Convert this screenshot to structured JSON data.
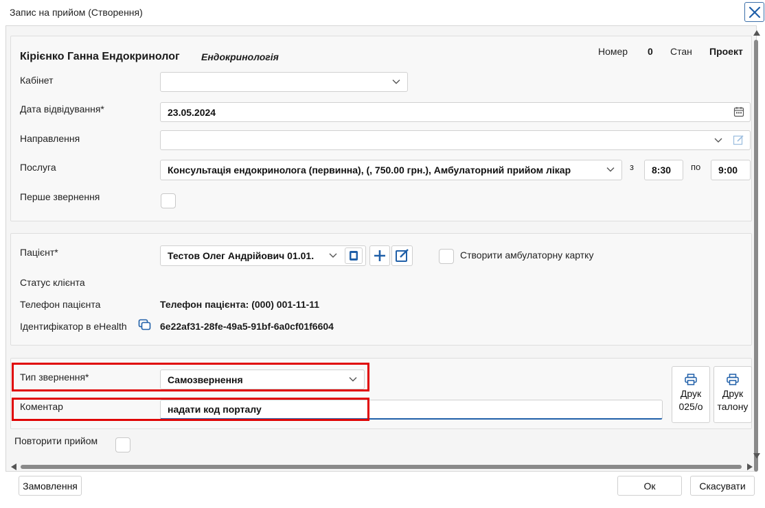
{
  "window": {
    "title": "Запис на прийом (Створення)"
  },
  "header": {
    "doctor": "Кірієнко Ганна Ендокринолог",
    "specialty": "Ендокринологія",
    "number_label": "Номер",
    "number_value": "0",
    "state_label": "Стан",
    "state_value": "Проект"
  },
  "form": {
    "cabinet_label": "Кабінет",
    "cabinet_value": "",
    "date_label": "Дата відвідування*",
    "date_value": "23.05.2024",
    "referral_label": "Направлення",
    "referral_value": "",
    "service_label": "Послуга",
    "service_value": "Консультація ендокринолога (первинна), (, 750.00 грн.), Амбулаторний прийом лікар",
    "from_label": "з",
    "from_value": "8:30",
    "to_label": "по",
    "to_value": "9:00",
    "first_visit_label": "Перше звернення"
  },
  "patient": {
    "patient_label": "Пацієнт*",
    "patient_value": "Тестов Олег Андрійович 01.01.",
    "create_card_label": "Створити амбулаторну картку",
    "status_label": "Статус клієнта",
    "phone_label": "Телефон пацієнта",
    "phone_value": "Телефон пацієнта: (000) 001-11-11",
    "ehealth_label": "Ідентифікатор в eHealth",
    "ehealth_value": "6e22af31-28fe-49a5-91bf-6a0cf01f6604"
  },
  "appeal": {
    "type_label": "Тип звернення*",
    "type_value": "Самозвернення",
    "comment_label": "Коментар",
    "comment_value": "надати код порталу",
    "print_025_line1": "Друк",
    "print_025_line2": "025/о",
    "print_ticket_line1": "Друк",
    "print_ticket_line2": "талону",
    "repeat_label": "Повторити прийом"
  },
  "footer": {
    "order_label": "Замовлення",
    "ok_label": "Ок",
    "cancel_label": "Скасувати"
  },
  "colors": {
    "accent": "#2b6cb0",
    "highlight": "#e00000",
    "comment_underline": "#1f5fa8"
  },
  "icons": [
    "close-icon",
    "chevron-down-icon",
    "calendar-icon",
    "edit-icon",
    "id-card-icon",
    "plus-icon",
    "copy-icon",
    "printer-icon",
    "scroll-up-icon",
    "scroll-down-icon",
    "scroll-left-icon",
    "scroll-right-icon"
  ]
}
